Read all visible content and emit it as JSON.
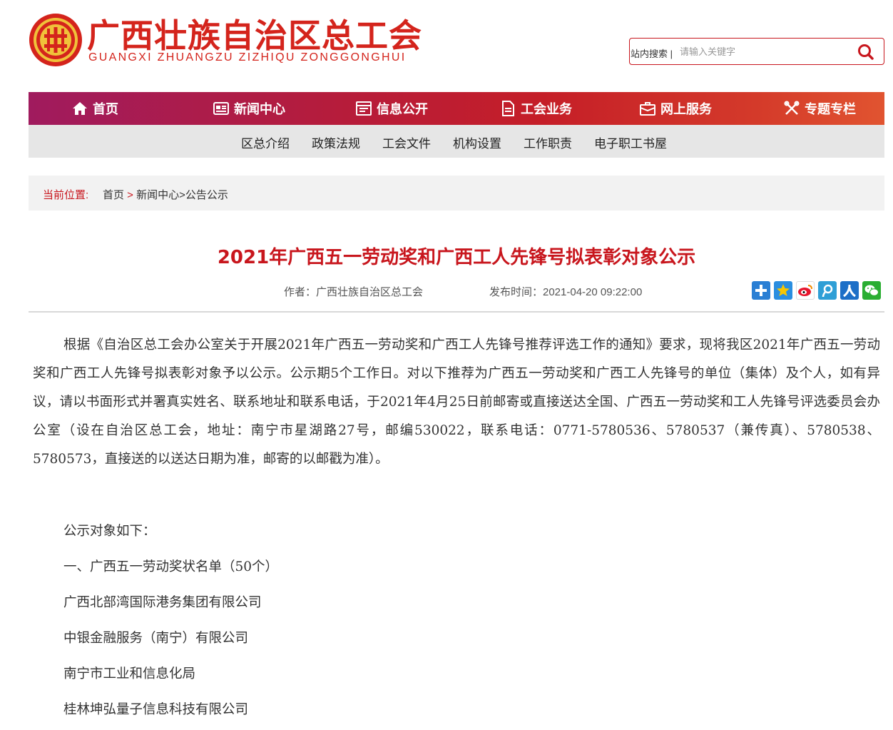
{
  "site": {
    "name_cn": "广西壮族自治区总工会",
    "name_en": "GUANGXI ZHUANGZU ZIZHIQU ZONGGONGHUI",
    "brand_color": "#c8161d"
  },
  "search": {
    "label": "站内搜索 |",
    "placeholder": "请输入关键字",
    "icon": "search-icon"
  },
  "nav": {
    "items": [
      {
        "label": "首页",
        "icon": "home-icon"
      },
      {
        "label": "新闻中心",
        "icon": "newspaper-icon"
      },
      {
        "label": "信息公开",
        "icon": "document-list-icon"
      },
      {
        "label": "工会业务",
        "icon": "file-icon"
      },
      {
        "label": "网上服务",
        "icon": "briefcase-icon"
      },
      {
        "label": "专题专栏",
        "icon": "tools-icon"
      }
    ],
    "active_index": 2
  },
  "subnav": {
    "items": [
      "区总介绍",
      "政策法规",
      "工会文件",
      "机构设置",
      "工作职责",
      "电子职工书屋"
    ]
  },
  "breadcrumb": {
    "label": "当前位置:",
    "items": [
      "首页",
      "新闻中心",
      "公告公示"
    ],
    "sep1": " > ",
    "sep2": ">"
  },
  "article": {
    "title": "2021年广西五一劳动奖和广西工人先锋号拟表彰对象公示",
    "author": "作者：广西壮族自治区总工会",
    "publish_time": "发布时间：2021-04-20 09:22:00",
    "share_icons": [
      "share-plus-icon",
      "qzone-icon",
      "weibo-icon",
      "tencent-weibo-icon",
      "renren-icon",
      "wechat-icon"
    ],
    "paragraph": "根据《自治区总工会办公室关于开展2021年广西五一劳动奖和广西工人先锋号推荐评选工作的通知》要求，现将我区2021年广西五一劳动奖和广西工人先锋号拟表彰对象予以公示。公示期5个工作日。对以下推荐为广西五一劳动奖和广西工人先锋号的单位（集体）及个人，如有异议，请以书面形式并署真实姓名、联系地址和联系电话，于2021年4月25日前邮寄或直接送达全国、广西五一劳动奖和工人先锋号评选委员会办公室（设在自治区总工会，地址：南宁市星湖路27号，邮编530022，联系电话：0771-5780536、5780537（兼传真）、5780538、5780573，直接送的以送达日期为准，邮寄的以邮戳为准）。",
    "list_intro": "公示对象如下：",
    "section_heading": "一、广西五一劳动奖状名单（50个）",
    "entries": [
      "广西北部湾国际港务集团有限公司",
      "中银金融服务（南宁）有限公司",
      "南宁市工业和信息化局",
      "桂林坤弘量子信息科技有限公司"
    ]
  }
}
